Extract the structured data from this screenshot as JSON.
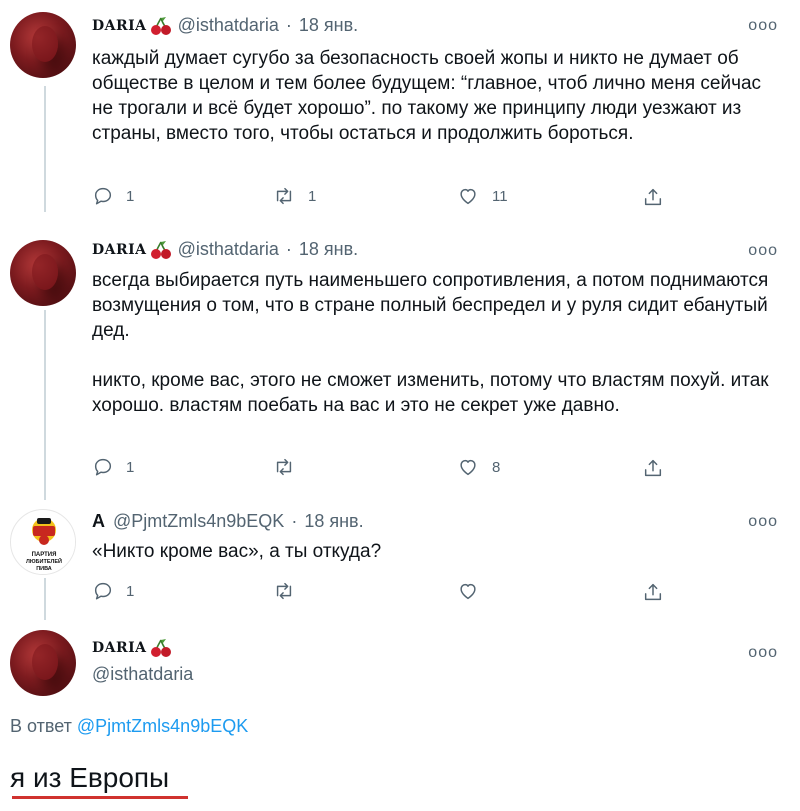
{
  "tweets": [
    {
      "name": "DARIA",
      "handle": "@isthatdaria",
      "separator": "·",
      "date": "18 янв.",
      "text": "каждый думает сугубо за безопасность своей жопы и никто не думает об обществе в целом и тем более будущем: “главное, чтоб лично меня сейчас не трогали и всё будет хорошо”. по такому же принципу люди уезжают из страны, вместо того, чтобы остаться и продолжить бороться.",
      "replies": "1",
      "retweets": "1",
      "likes": "11"
    },
    {
      "name": "DARIA",
      "handle": "@isthatdaria",
      "separator": "·",
      "date": "18 янв.",
      "text": "всегда выбирается путь наименьшего сопротивления, а потом поднимаются возмущения о том, что в стране полный беспредел и у руля сидит ебанутый дед.\n\nникто, кроме вас, этого не сможет изменить, потому что властям похуй. итак хорошо. властям поебать на вас и это не секрет уже давно.",
      "replies": "1",
      "retweets": "",
      "likes": "8"
    },
    {
      "name": "A",
      "handle": "@PjmtZmls4n9bEQK",
      "separator": "·",
      "date": "18 янв.",
      "text": "«Никто кроме вас», а ты откуда?",
      "replies": "1",
      "retweets": "",
      "likes": "",
      "avatar_text": [
        "ПАРТИЯ",
        "ЛЮБИТЕЛЕЙ",
        "ПИВА"
      ]
    }
  ],
  "main_tweet": {
    "name": "DARIA",
    "handle": "@isthatdaria",
    "reply_prefix": "В ответ",
    "reply_handle": "@PjmtZmls4n9bEQK",
    "text": "я из Европы"
  },
  "more_label": "ooo",
  "colors": {
    "accent": "#1d9bf0",
    "muted": "#536471",
    "thread_line": "#cfd9de",
    "underline": "#d0322f",
    "avatar_red": "#7d1b1f",
    "party_red": "#c8281f",
    "party_yellow": "#f3c21b"
  },
  "icons": [
    "reply-icon",
    "retweet-icon",
    "like-icon",
    "share-icon",
    "more-icon",
    "cherry-icon"
  ]
}
